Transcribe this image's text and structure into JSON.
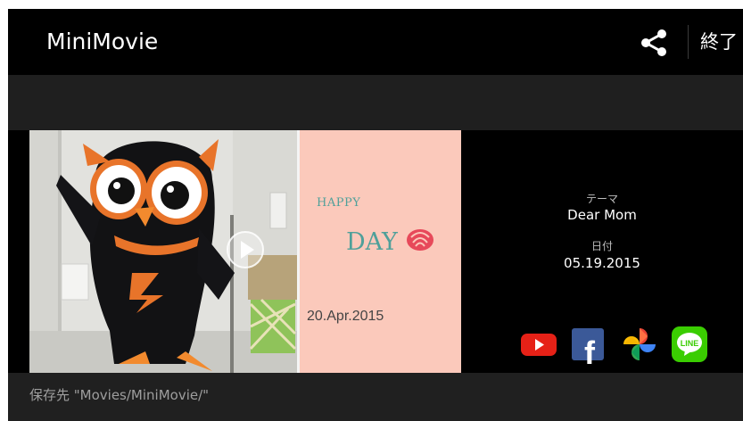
{
  "app": {
    "title": "MiniMovie",
    "exit_label": "終了"
  },
  "icons": {
    "share": "share-icon",
    "play": "play-icon",
    "youtube": "youtube-icon",
    "facebook": "facebook-icon",
    "photos": "google-photos-icon",
    "line": "line-icon"
  },
  "preview": {
    "card": {
      "happy": "HAPPY",
      "day": "DAY",
      "date": "20.Apr.2015"
    }
  },
  "info": {
    "theme_label": "テーマ",
    "theme_value": "Dear Mom",
    "date_label": "日付",
    "date_value": "05.19.2015"
  },
  "sns": {
    "line_text": "LINE",
    "facebook_glyph": "f"
  },
  "footer": {
    "save_path": "保存先 \"Movies/MiniMovie/\""
  },
  "colors": {
    "appbar": "#000000",
    "background": "#202020",
    "card": "#fbc9bb",
    "card_text": "#4fa09a",
    "youtube": "#e62117",
    "facebook": "#3b5998",
    "line": "#3acd01"
  }
}
